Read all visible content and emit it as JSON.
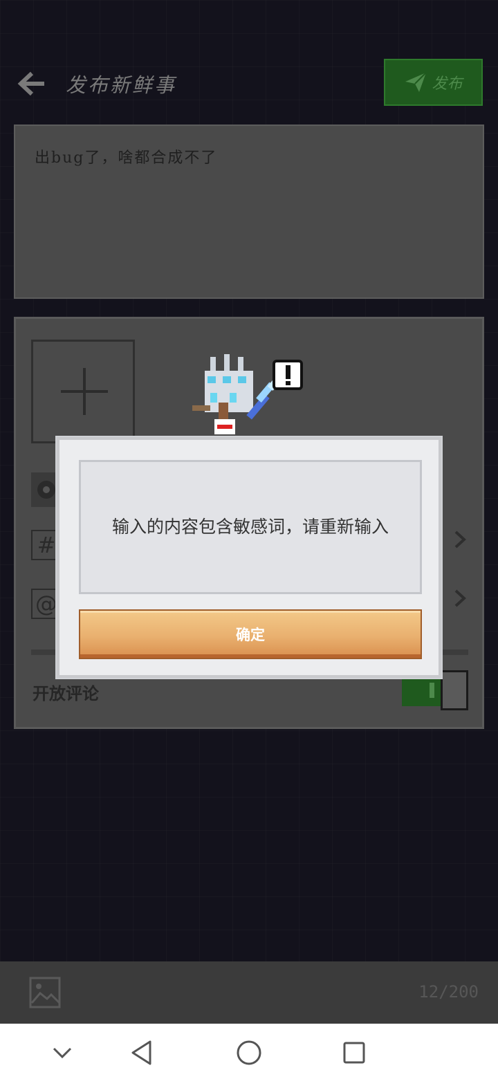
{
  "header": {
    "title": "发布新鲜事",
    "publish_label": "发布"
  },
  "editor": {
    "content": "出bug了，啥都合成不了"
  },
  "options": {
    "comments_label": "开放评论",
    "comments_enabled": true,
    "topic_symbol": "#",
    "mention_symbol": "@"
  },
  "dialog": {
    "message": "输入的内容包含敏感词，请重新输入",
    "confirm_label": "确定"
  },
  "footer": {
    "char_count": "12/200"
  },
  "colors": {
    "accent_green": "#1f5a1e",
    "confirm_orange": "#e9b06f",
    "background": "#13121c"
  },
  "icons": [
    "arrow-left-icon",
    "paper-plane-icon",
    "plus-icon",
    "aperture-icon",
    "chevron-right-icon",
    "image-icon",
    "chevron-down-icon",
    "triangle-back-icon",
    "circle-home-icon",
    "square-recents-icon"
  ]
}
